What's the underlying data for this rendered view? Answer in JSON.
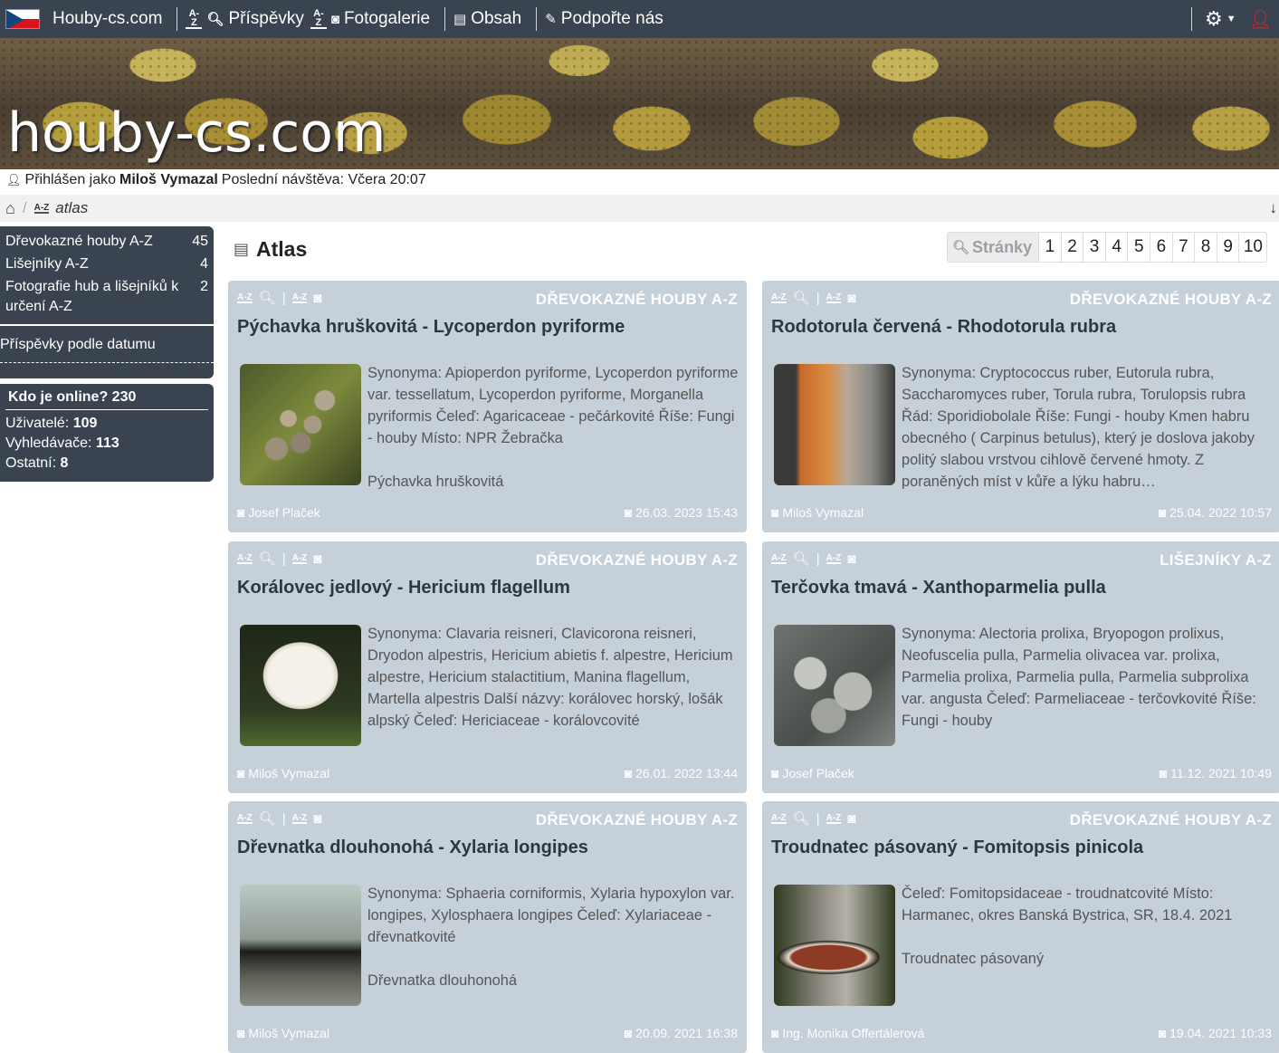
{
  "topnav": {
    "site": "Houby-cs.com",
    "items": [
      {
        "label": "Příspěvky"
      },
      {
        "label": "Fotogalerie"
      },
      {
        "label": "Obsah"
      },
      {
        "label": "Podpořte nás"
      }
    ],
    "az": "A-Z"
  },
  "banner": {
    "logo": "houby-cs.com"
  },
  "login": {
    "prefix": "Přihlášen jako",
    "user": "Miloš Vymazal",
    "last_visit": "Poslední návštěva: Včera 20:07"
  },
  "breadcrumb": {
    "current": "atlas",
    "az": "A-Z"
  },
  "sidebar": {
    "categories": [
      {
        "label": "Dřevokazné houby A-Z",
        "count": "45"
      },
      {
        "label": "Lišejníky A-Z",
        "count": "4"
      },
      {
        "label": "Fotografie hub a lišejníků k určení A-Z",
        "count": "2"
      }
    ],
    "by_date": "Příspěvky podle datumu"
  },
  "online": {
    "title": "Kdo je online? 230",
    "users_label": "Uživatelé:",
    "users": "109",
    "bots_label": "Vyhledávače:",
    "bots": "113",
    "other_label": "Ostatní:",
    "other": "8"
  },
  "main": {
    "title": "Atlas",
    "pager_label": "Stránky",
    "pages": [
      "1",
      "2",
      "3",
      "4",
      "5",
      "6",
      "7",
      "8",
      "9",
      "10"
    ]
  },
  "cards": [
    {
      "category": "DŘEVOKAZNÉ HOUBY A-Z",
      "title": "Pýchavka hruškovitá - Lycoperdon pyriforme",
      "text": "Synonyma: Apioperdon pyriforme, Lycoperdon pyriforme var. tessellatum, Lycoperdon pyriforme, Morganella pyriformis Čeleď: Agaricaceae - pečárkovité Říše: Fungi - houby Místo: NPR Žebračka",
      "sub": "Pýchavka hruškovitá",
      "author": "Josef Plaček",
      "date": "26.03. 2023 15:43"
    },
    {
      "category": "DŘEVOKAZNÉ HOUBY A-Z",
      "title": "Rodotorula červená - Rhodotorula rubra",
      "text": "Synonyma: Cryptococcus ruber, Eutorula rubra, Saccharomyces ruber, Torula rubra, Torulopsis rubra Řád: Sporidiobolale Říše: Fungi - houby Kmen habru obecného ( Carpinus betulus), který je doslova jakoby politý slabou vrstvou cihlově červené hmoty. Z poraněných míst v kůře a lýku habru…",
      "sub": "",
      "author": "Miloš Vymazal",
      "date": "25.04. 2022 10:57"
    },
    {
      "category": "DŘEVOKAZNÉ HOUBY A-Z",
      "title": "Korálovec jedlový - Hericium flagellum",
      "text": "Synonyma: Clavaria reisneri, Clavicorona reisneri, Dryodon alpestris, Hericium abietis f. alpestre, Hericium alpestre, Hericium stalactitium, Manina flagellum, Martella alpestris Další názvy: korálovec horský, lošák alpský Čeleď: Hericiaceae - korálovcovité",
      "sub": "",
      "author": "Miloš Vymazal",
      "date": "26.01. 2022 13:44"
    },
    {
      "category": "LIŠEJNÍKY A-Z",
      "title": "Terčovka tmavá - Xanthoparmelia pulla",
      "text": "Synonyma: Alectoria prolixa, Bryopogon prolixus, Neofuscelia pulla, Parmelia olivacea var. prolixa, Parmelia prolixa, Parmelia pulla, Parmelia subprolixa var. angusta Čeleď: Parmeliaceae - terčovkovité Říše: Fungi - houby",
      "sub": "",
      "author": "Josef Plaček",
      "date": "11.12. 2021 10:49"
    },
    {
      "category": "DŘEVOKAZNÉ HOUBY A-Z",
      "title": "Dřevnatka dlouhonohá - Xylaria longipes",
      "text": "Synonyma: Sphaeria corniformis, Xylaria hypoxylon var. longipes, Xylosphaera longipes Čeleď: Xylariaceae - dřevnatkovité",
      "sub": "Dřevnatka dlouhonohá",
      "author": "Miloš Vymazal",
      "date": "20.09. 2021 16:38"
    },
    {
      "category": "DŘEVOKAZNÉ HOUBY A-Z",
      "title": "Troudnatec pásovaný - Fomitopsis pinicola",
      "text": "Čeleď: Fomitopsidaceae - troudnatcovité Místo: Harmanec, okres Banská Bystrica, SR, 18.4. 2021",
      "sub": "Troudnatec pásovaný",
      "author": "Ing. Monika Offertálerová",
      "date": "19.04. 2021 10:33"
    }
  ]
}
